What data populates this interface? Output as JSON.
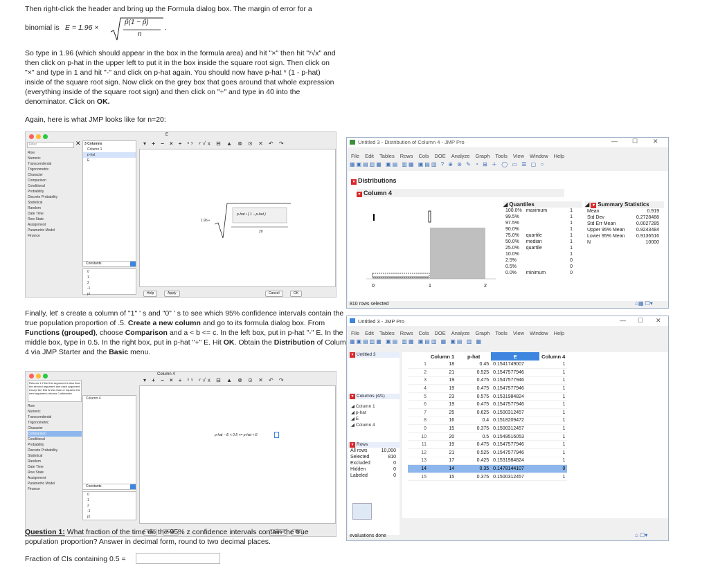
{
  "intro": {
    "line1": "Then right-click the header and bring up the Formula dialog box. The margin of error for a",
    "formula_label": "binomial is",
    "formula_e": "E = 1.96 ×",
    "formula_num": "p̂(1 − p̂)",
    "formula_den": "n",
    "para": "So type in 1.96 (which should appear in the box in the formula area) and hit \"×\" then hit \"ʸ√x\" and then click on p-hat in the upper left to put it in the box inside the square root sign. Then click on \"×\" and type in 1 and hit \"-\" and click on p-hat again. You should now have p-hat * (1 - p-hat) inside of the square root sign. Now click on the grey box that goes around that whole expression (everything inside of the square root sign) and then click on \"÷\" and type in 40 into the denominator. Click on",
    "para_ok": "OK.",
    "again": "Again, here is what JMP looks like for n=20:"
  },
  "formula_dialog1": {
    "title": "E",
    "filter_placeholder": "Filter",
    "col_header": "3 Columns",
    "columns": [
      "Column 1",
      "p-hat",
      "E"
    ],
    "functions": [
      "Row",
      "Numeric",
      "Transcendental",
      "Trigonometric",
      "Character",
      "Comparison",
      "Conditional",
      "Probability",
      "Discrete Probability",
      "Statistical",
      "Random",
      "Date Time",
      "Row State",
      "Assignment",
      "Parametric Model",
      "Finance"
    ],
    "constants_label": "Constants",
    "constants": [
      "0",
      "1",
      "2",
      "-1",
      "pi"
    ],
    "expr_coef": "1.96 •",
    "expr_inner": "p-hat • ( 1 − p-hat )",
    "expr_den": "20",
    "help": "Help",
    "apply": "Apply",
    "cancel": "Cancel",
    "ok": "OK"
  },
  "dist_window": {
    "title": "Untitled 3 - Distribution of Column 4 - JMP Pro",
    "menu": [
      "File",
      "Edit",
      "Tables",
      "Rows",
      "Cols",
      "DOE",
      "Analyze",
      "Graph",
      "Tools",
      "View",
      "Window",
      "Help"
    ],
    "distributions": "Distributions",
    "column": "Column 4",
    "axis_ticks": [
      "0",
      "1",
      "2"
    ],
    "quantiles_title": "Quantiles",
    "quantiles": [
      [
        "100.0%",
        "maximum",
        "1"
      ],
      [
        "99.5%",
        "",
        "1"
      ],
      [
        "97.5%",
        "",
        "1"
      ],
      [
        "90.0%",
        "",
        "1"
      ],
      [
        "75.0%",
        "quartile",
        "1"
      ],
      [
        "50.0%",
        "median",
        "1"
      ],
      [
        "25.0%",
        "quartile",
        "1"
      ],
      [
        "10.0%",
        "",
        "1"
      ],
      [
        "2.5%",
        "",
        "0"
      ],
      [
        "0.5%",
        "",
        "0"
      ],
      [
        "0.0%",
        "minimum",
        "0"
      ]
    ],
    "summary_title": "Summary Statistics",
    "summary": [
      [
        "Mean",
        "0.919"
      ],
      [
        "Std Dev",
        "0.2728488"
      ],
      [
        "Std Err Mean",
        "0.0027285"
      ],
      [
        "Upper 95% Mean",
        "0.9243484"
      ],
      [
        "Lower 95% Mean",
        "0.9136516"
      ],
      [
        "N",
        "10000"
      ]
    ],
    "status": "810 rows selected"
  },
  "para2": {
    "text_a": "Finally, let' s create a column of \"1\" ' s and \"0\" ' s to see which 95% confidence intervals contain the true population proportion of .5.",
    "bold_a": "Create a new column",
    "text_b": "and go to its formula dialog box. From",
    "bold_b": "Functions (grouped)",
    "text_c": ", choose",
    "bold_c": "Comparison",
    "text_d": "and a < b <= c. In the left box, put in p-hat \"-\" E. In the middle box, type in 0.5. In the right box, put in p-hat \"+\" E. Hit",
    "bold_d": "OK",
    "text_e": ". Obtain the",
    "bold_e": "Distribution",
    "text_f": "of Column 4 via JMP Starter and the",
    "bold_f": "Basic",
    "text_g": "menu."
  },
  "formula_dialog2": {
    "title": "Column 4",
    "tooltip": "Returns 1 if the first argument is less than the second argument and each argument except the first is less than or equal to the next argument; returns 0 otherwise.",
    "column": "Column 4",
    "expr": "p-hat − E < 0.5 <= p-hat + E",
    "constants_label": "Constants",
    "help": "Help",
    "apply": "Apply",
    "cancel": "Cancel",
    "ok": "OK"
  },
  "table_window": {
    "title": "Untitled 3 - JMP Pro",
    "tab": "Untitled 3",
    "menu": [
      "File",
      "Edit",
      "Tables",
      "Rows",
      "Cols",
      "DOE",
      "Analyze",
      "Graph",
      "Tools",
      "View",
      "Window",
      "Help"
    ],
    "columns_header": "Columns (4/1)",
    "column_list": [
      "Column 1",
      "p-hat",
      "E",
      "Column 4"
    ],
    "rows_header": "Rows",
    "rows_stats": [
      [
        "All rows",
        "10,000"
      ],
      [
        "Selected",
        "810"
      ],
      [
        "Excluded",
        "0"
      ],
      [
        "Hidden",
        "0"
      ],
      [
        "Labeled",
        "0"
      ]
    ],
    "headers": [
      "Column 1",
      "p-hat",
      "E",
      "Column 4"
    ],
    "rows": [
      [
        "1",
        "18",
        "0.45",
        "0.1541749007",
        "1"
      ],
      [
        "2",
        "21",
        "0.525",
        "0.1547577946",
        "1"
      ],
      [
        "3",
        "19",
        "0.475",
        "0.1547577946",
        "1"
      ],
      [
        "4",
        "19",
        "0.475",
        "0.1547577946",
        "1"
      ],
      [
        "5",
        "23",
        "0.575",
        "0.1531984824",
        "1"
      ],
      [
        "6",
        "19",
        "0.475",
        "0.1547577946",
        "1"
      ],
      [
        "7",
        "25",
        "0.625",
        "0.1500312457",
        "1"
      ],
      [
        "8",
        "16",
        "0.4",
        "0.1518209472",
        "1"
      ],
      [
        "9",
        "15",
        "0.375",
        "0.1500312457",
        "1"
      ],
      [
        "10",
        "20",
        "0.5",
        "0.1549516053",
        "1"
      ],
      [
        "11",
        "19",
        "0.475",
        "0.1547577946",
        "1"
      ],
      [
        "12",
        "21",
        "0.525",
        "0.1547577946",
        "1"
      ],
      [
        "13",
        "17",
        "0.425",
        "0.1531984824",
        "1"
      ],
      [
        "14",
        "14",
        "0.35",
        "0.1478144107",
        "0"
      ],
      [
        "15",
        "15",
        "0.375",
        "0.1500312457",
        "1"
      ]
    ],
    "status": "evaluations done"
  },
  "question": {
    "label": "Question 1:",
    "text": "What fraction of the time do the 95% z confidence intervals contain the true population proportion? Answer in decimal form, round to two decimal places.",
    "answer_label": "Fraction of CIs containing 0.5 =",
    "answer_value": ""
  }
}
